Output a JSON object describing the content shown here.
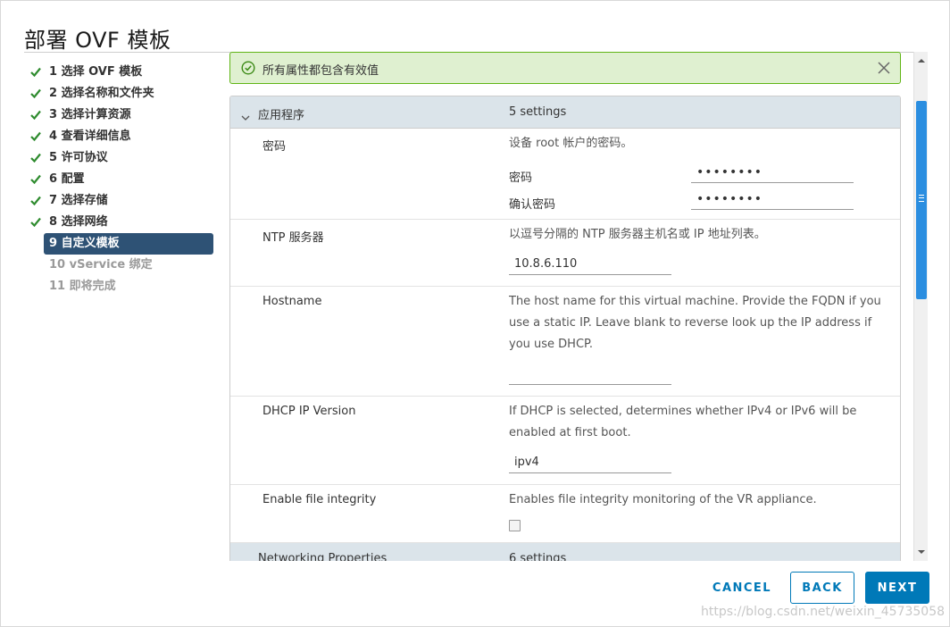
{
  "dialog": {
    "title": "部署 OVF 模板"
  },
  "steps": [
    {
      "label": "1 选择 OVF 模板",
      "state": "done"
    },
    {
      "label": "2 选择名称和文件夹",
      "state": "done"
    },
    {
      "label": "3 选择计算资源",
      "state": "done"
    },
    {
      "label": "4 查看详细信息",
      "state": "done"
    },
    {
      "label": "5 许可协议",
      "state": "done"
    },
    {
      "label": "6 配置",
      "state": "done"
    },
    {
      "label": "7 选择存储",
      "state": "done"
    },
    {
      "label": "8 选择网络",
      "state": "done"
    },
    {
      "label": "9 自定义模板",
      "state": "active"
    },
    {
      "label": "10 vService 绑定",
      "state": "pending"
    },
    {
      "label": "11 即将完成",
      "state": "pending"
    }
  ],
  "alert": {
    "message": "所有属性都包含有效值",
    "icon": "check-circle-icon"
  },
  "groups": [
    {
      "name": "应用程序",
      "count": "5 settings"
    },
    {
      "name": "Networking Properties",
      "count": "6 settings"
    }
  ],
  "properties": {
    "password": {
      "label": "密码",
      "description": "设备 root 帐户的密码。",
      "field_label": "密码",
      "field_value": "••••••••",
      "confirm_label": "确认密码",
      "confirm_value": "••••••••"
    },
    "ntp": {
      "label": "NTP 服务器",
      "description": "以逗号分隔的 NTP 服务器主机名或 IP 地址列表。",
      "value": "10.8.6.110"
    },
    "hostname": {
      "label": "Hostname",
      "description": "The host name for this virtual machine. Provide the FQDN if you use a static IP. Leave blank to reverse look up the IP address if you use DHCP.",
      "value": ""
    },
    "dhcp": {
      "label": "DHCP IP Version",
      "description": "If DHCP is selected, determines whether IPv4 or IPv6 will be enabled at first boot.",
      "value": "ipv4"
    },
    "integrity": {
      "label": "Enable file integrity",
      "description": "Enables file integrity monitoring of the VR appliance.",
      "checked": false
    }
  },
  "buttons": {
    "cancel": "CANCEL",
    "back": "BACK",
    "next": "NEXT"
  },
  "watermark": "https://blog.csdn.net/weixin_45735058",
  "colors": {
    "accent": "#0079b8",
    "active_step": "#2e5275",
    "success": "#60b515",
    "success_bg": "#dff0d0",
    "check": "#2e8b2e"
  }
}
